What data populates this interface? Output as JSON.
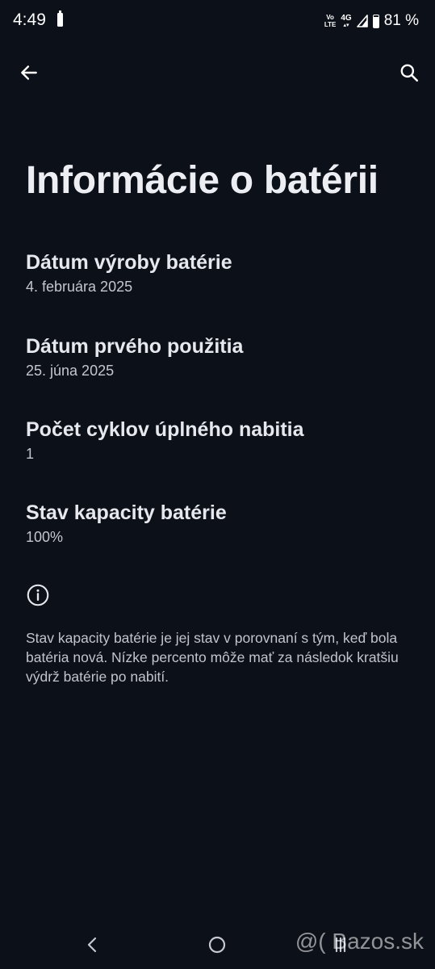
{
  "status_bar": {
    "time": "4:49",
    "volte_line1": "Vo",
    "volte_line2": "LTE",
    "network": "4G",
    "battery_percent": "81 %",
    "battery_level": 0.81
  },
  "app_bar": {
    "back_icon": "arrow-back-icon",
    "search_icon": "search-icon"
  },
  "page": {
    "title": "Informácie o batérii"
  },
  "items": [
    {
      "label": "Dátum výroby batérie",
      "value": "4. februára 2025"
    },
    {
      "label": "Dátum prvého použitia",
      "value": "25. júna 2025"
    },
    {
      "label": "Počet cyklov úplného nabitia",
      "value": "1"
    },
    {
      "label": "Stav kapacity batérie",
      "value": "100%"
    }
  ],
  "note": {
    "icon": "info-icon",
    "text": "Stav kapacity batérie je jej stav v porovnaní s tým, keď bola batéria nová. Nízke percento môže mať za následok kratšiu výdrž batérie po nabití."
  },
  "nav_bar": {
    "back_icon": "nav-back-icon",
    "home_icon": "nav-home-icon",
    "recents_icon": "nav-recents-icon"
  },
  "watermark": "@( Bazos.sk"
}
